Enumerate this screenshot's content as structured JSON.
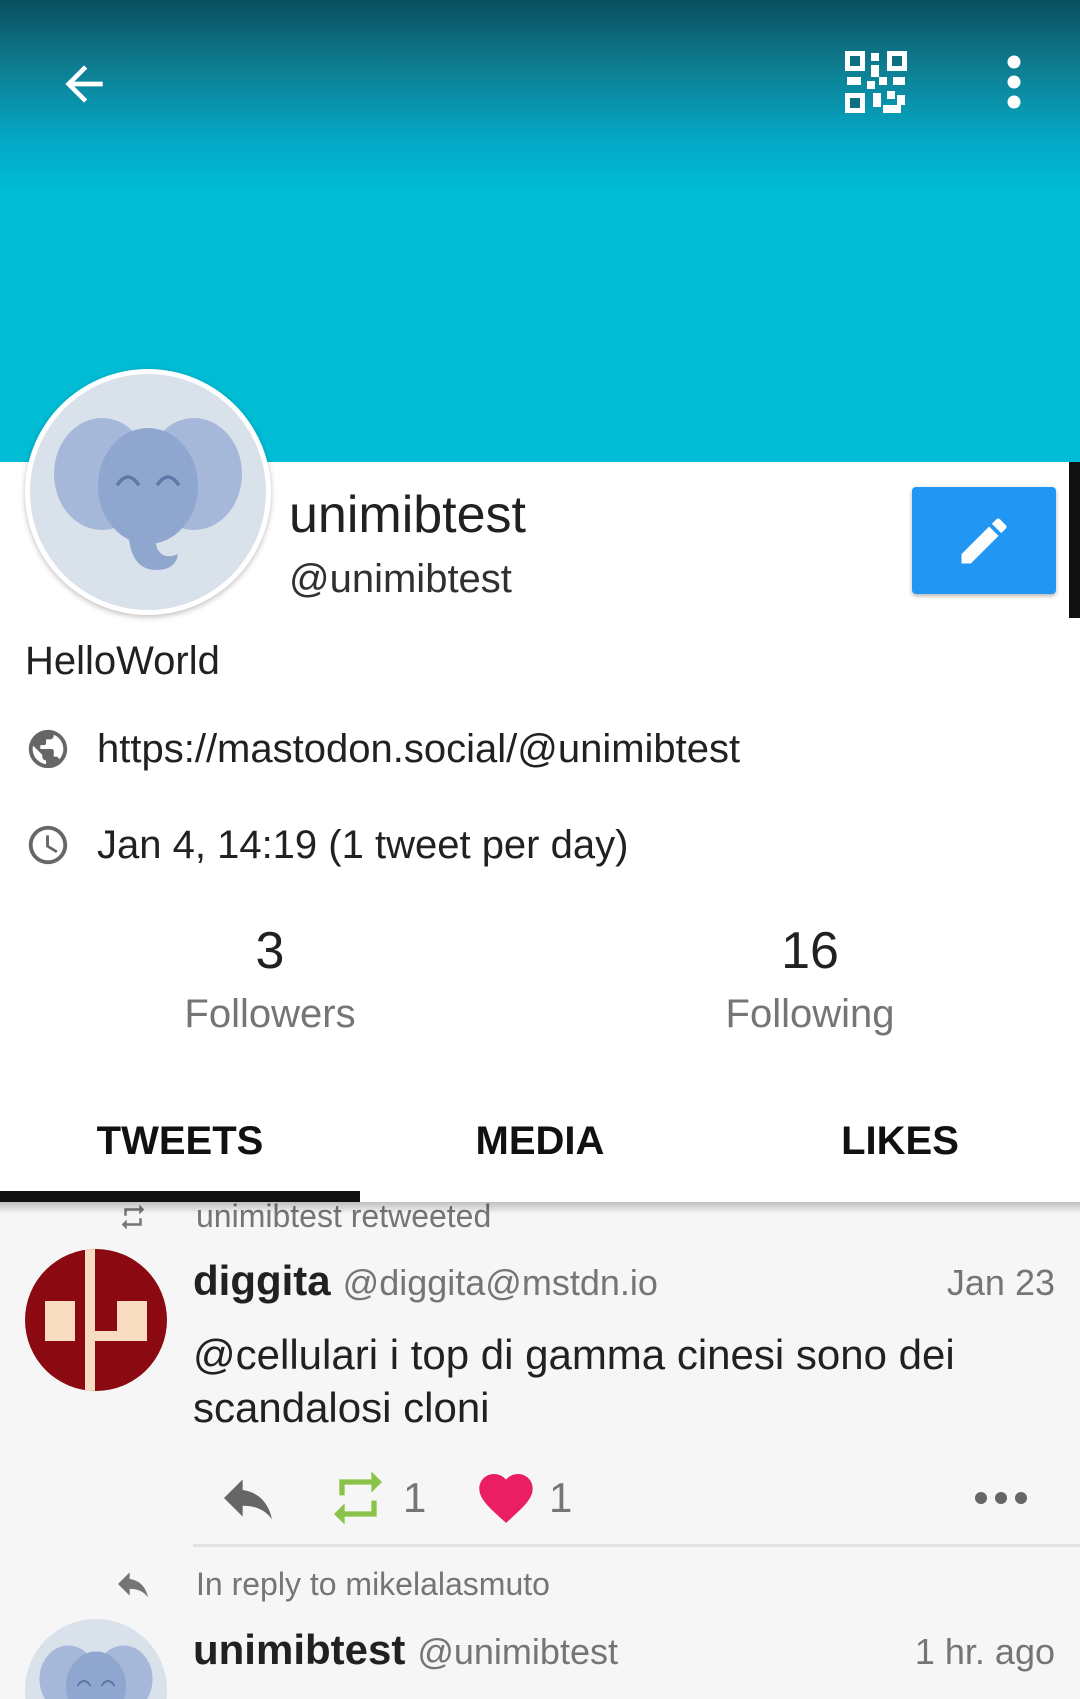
{
  "header": {
    "back_icon": "arrow-left-icon",
    "qr_icon": "qr-code-icon",
    "more_icon": "more-vertical-icon",
    "banner_color": "#00bcd4"
  },
  "profile": {
    "display_name": "unimibtest",
    "handle": "@unimibtest",
    "bio": "HelloWorld",
    "website": "https://mastodon.social/@unimibtest",
    "joined": "Jan 4, 14:19 (1 tweet per day)",
    "edit_color": "#2196f3"
  },
  "stats": {
    "followers_count": "3",
    "followers_label": "Followers",
    "following_count": "16",
    "following_label": "Following"
  },
  "tabs": [
    {
      "label": "TWEETS",
      "selected": true
    },
    {
      "label": "MEDIA",
      "selected": false
    },
    {
      "label": "LIKES",
      "selected": false
    }
  ],
  "feed": {
    "post1": {
      "retweeted_by": "unimibtest retweeted",
      "name": "diggita",
      "username": "@diggita@mstdn.io",
      "date": "Jan 23",
      "text": "@cellulari i top di gamma cinesi sono dei scandalosi cloni",
      "retweet_count": "1",
      "like_count": "1",
      "retweet_color": "#8bc34a",
      "like_color": "#e91e63"
    },
    "post2": {
      "reply_to": "In reply to mikelalasmuto",
      "name": "unimibtest",
      "username": "@unimibtest",
      "date": "1 hr. ago"
    }
  }
}
